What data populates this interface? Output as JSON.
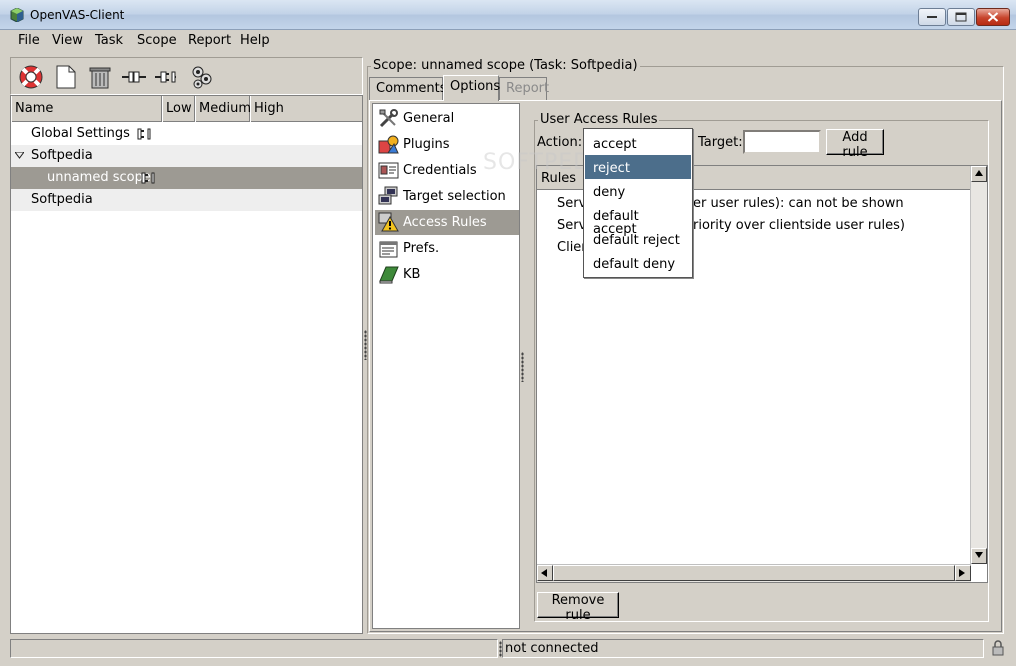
{
  "window": {
    "title": "OpenVAS-Client"
  },
  "menu": [
    "File",
    "View",
    "Task",
    "Scope",
    "Report",
    "Help"
  ],
  "toolbar_icons": [
    "lifebuoy-icon",
    "new-document-icon",
    "trash-icon",
    "connect-icon",
    "disconnect-icon",
    "scan-icon"
  ],
  "tree": {
    "columns": [
      "Name",
      "Low",
      "Medium",
      "High"
    ],
    "rows": [
      {
        "label": "Global Settings"
      },
      {
        "label": "Softpedia"
      },
      {
        "label": "unnamed scope"
      },
      {
        "label": "Softpedia"
      }
    ]
  },
  "scope": {
    "title": "Scope: unnamed scope (Task: Softpedia)",
    "tabs": [
      "Comments",
      "Options",
      "Report"
    ],
    "options": [
      "General",
      "Plugins",
      "Credentials",
      "Target selection",
      "Access Rules",
      "Prefs.",
      "KB"
    ]
  },
  "uar": {
    "title": "User Access Rules",
    "action_label": "Action:",
    "target_label": "Target:",
    "target_value": "",
    "add_rule": "Add rule",
    "rules_header": "Rules",
    "rules": [
      "Serv",
      "er user rules): can not be shown",
      "Serv",
      "riority over clientside user rules)",
      "Clien"
    ],
    "remove_rule": "Remove rule"
  },
  "action_popup": {
    "options": [
      "accept",
      "reject",
      "deny",
      "default accept",
      "default reject",
      "default deny"
    ],
    "selected": "reject"
  },
  "watermark": "SOFTPEDIA",
  "status": {
    "text": "not connected"
  }
}
